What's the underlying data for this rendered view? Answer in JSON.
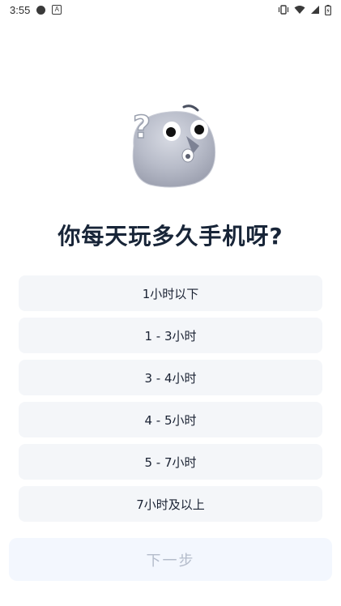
{
  "status_bar": {
    "time": "3:55",
    "icons": [
      "circle-icon",
      "a-notification-icon",
      "vibrate-icon",
      "wifi-icon",
      "signal-icon",
      "battery-icon"
    ]
  },
  "mascot": {
    "description_icon": "confused-face-mascot-icon"
  },
  "question": {
    "title": "你每天玩多久手机呀?"
  },
  "options": [
    {
      "label": "1小时以下"
    },
    {
      "label": "1 - 3小时"
    },
    {
      "label": "3 - 4小时"
    },
    {
      "label": "4 - 5小时"
    },
    {
      "label": "5 - 7小时"
    },
    {
      "label": "7小时及以上"
    }
  ],
  "next_button": {
    "label": "下一步",
    "enabled": false
  },
  "colors": {
    "title": "#182538",
    "option_bg": "#f4f6f9",
    "next_bg": "#f3f7fe",
    "next_text": "#b4bccb"
  }
}
